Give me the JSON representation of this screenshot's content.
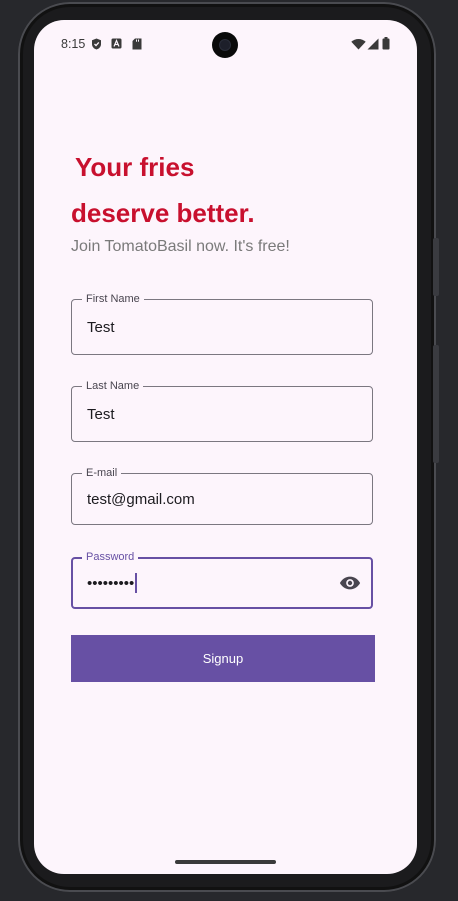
{
  "status_bar": {
    "time": "8:15"
  },
  "signup": {
    "headline_line1": "Your fries",
    "headline_line2": "deserve better.",
    "subtitle": "Join TomatoBasil now. It's free!",
    "fields": [
      {
        "label": "First Name",
        "value": "Test"
      },
      {
        "label": "Last Name",
        "value": "Test"
      },
      {
        "label": "E-mail",
        "value": "test@gmail.com"
      },
      {
        "label": "Password",
        "value": "•••••••••"
      }
    ],
    "button_label": "Signup"
  },
  "colors": {
    "headline": "#c8102e",
    "accent": "#6750a4",
    "background": "#fdf5fc"
  },
  "icons": [
    "shield-icon",
    "translate-icon",
    "sd-card-icon",
    "wifi-icon",
    "signal-icon",
    "battery-icon",
    "visibility-icon"
  ]
}
